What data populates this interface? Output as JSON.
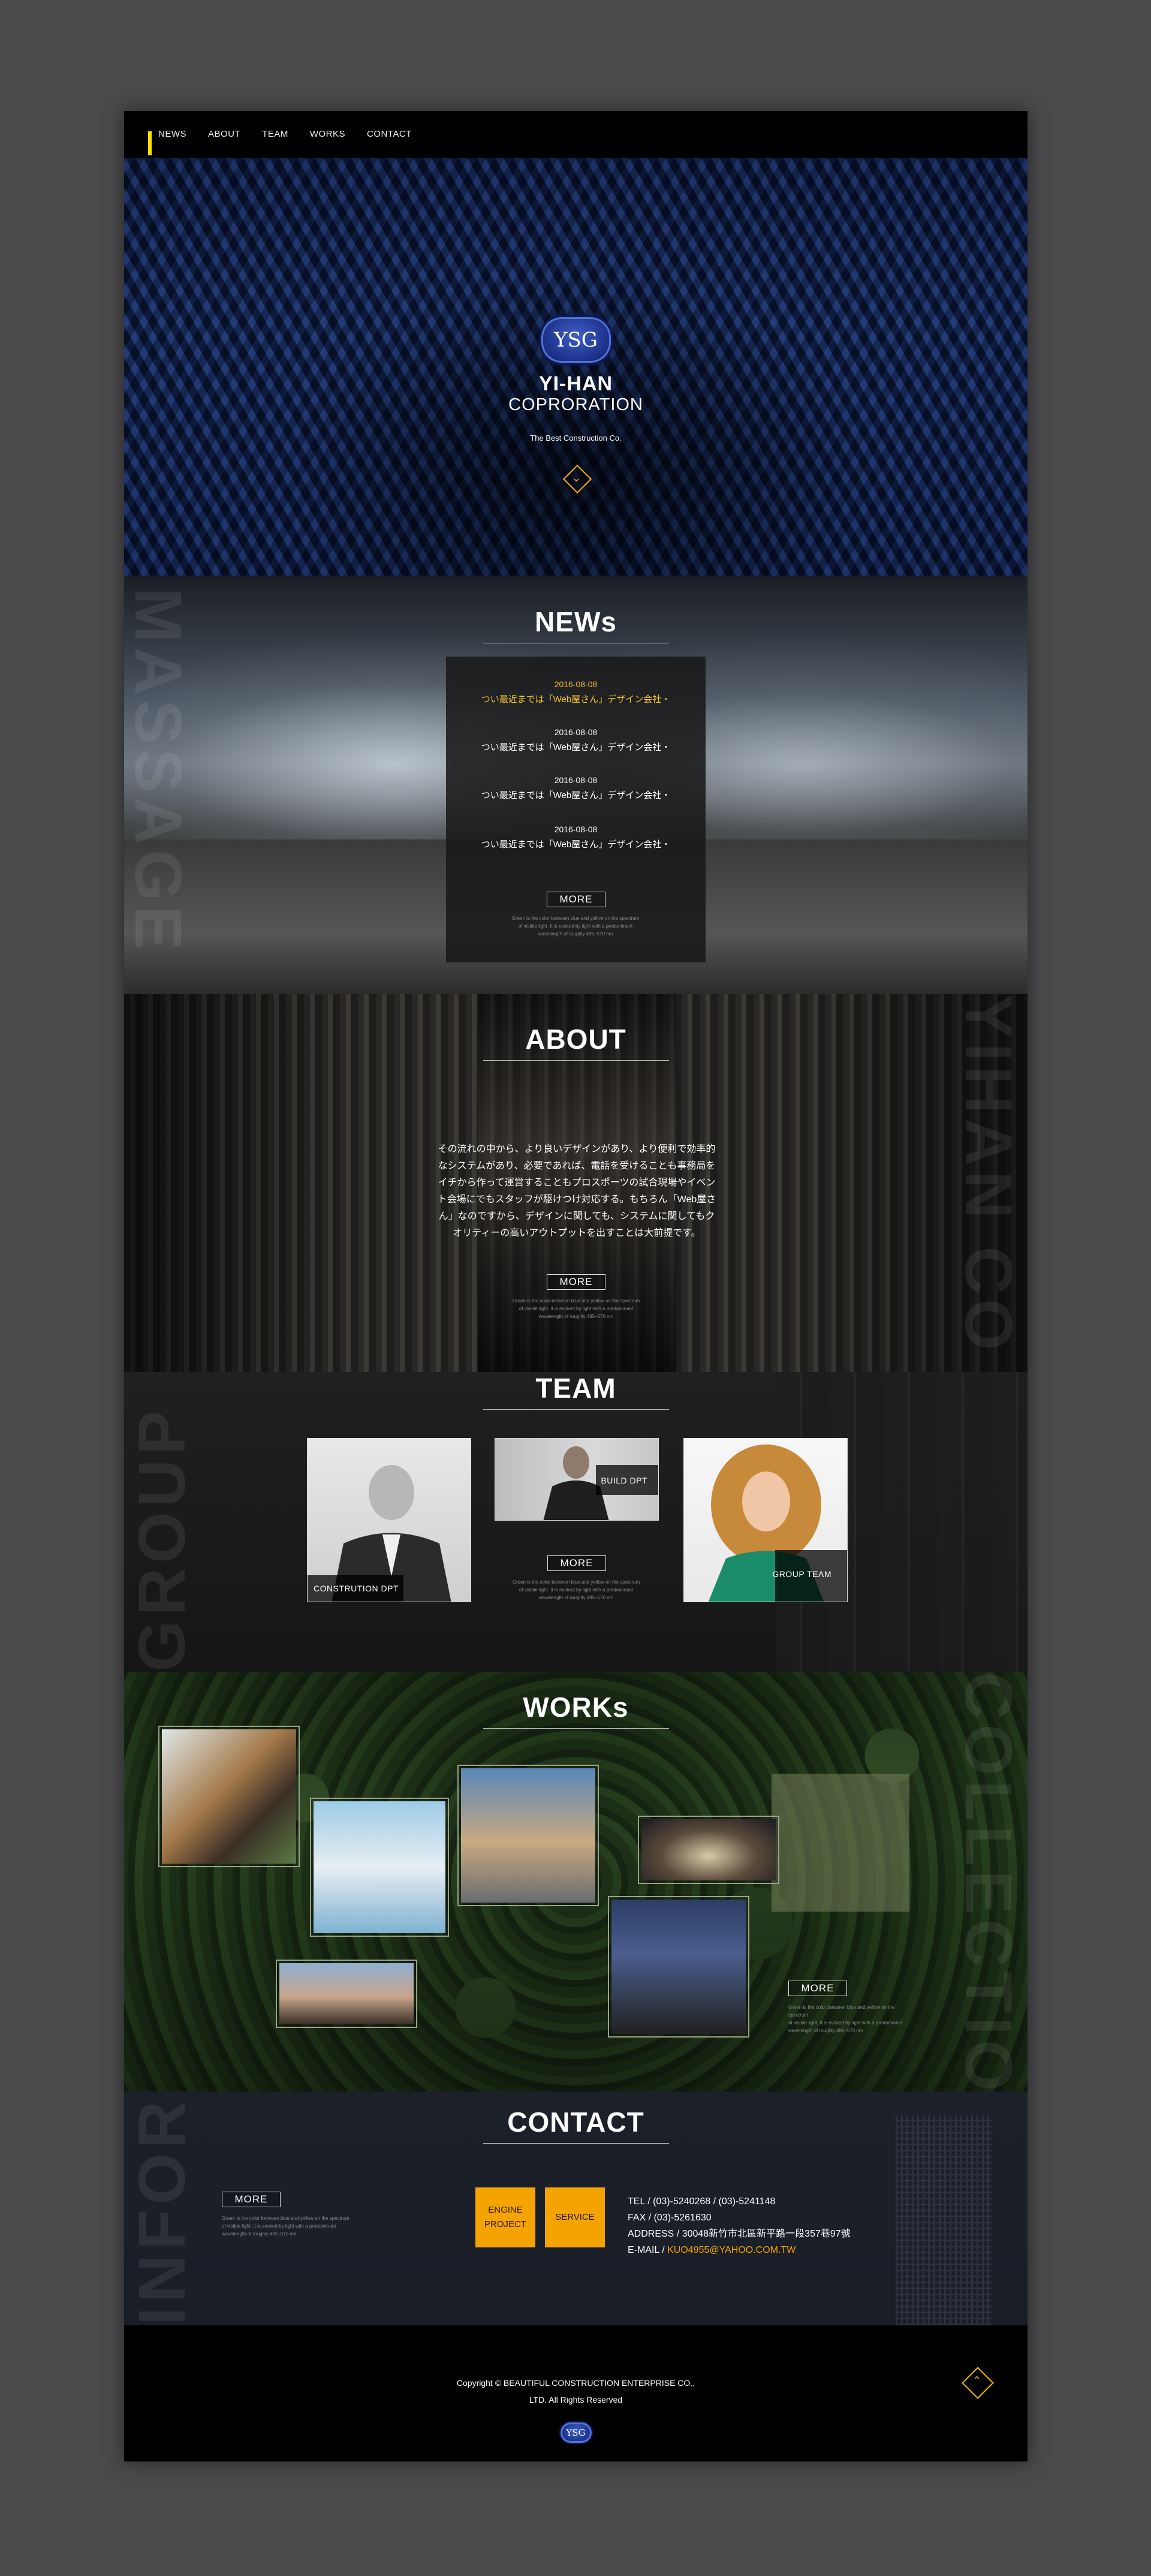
{
  "nav": [
    "NEWS",
    "ABOUT",
    "TEAM",
    "WORKS",
    "CONTACT"
  ],
  "hero": {
    "logo": "YSG",
    "brand": "YI-HAN",
    "brand2": "COPRORATION",
    "tagline": "The Best Construction Co."
  },
  "news": {
    "title": "NEWs",
    "side": "MASSAGE",
    "items": [
      {
        "date": "2016-08-08",
        "text": "つい最近までは「Web屋さん」デザイン会社・"
      },
      {
        "date": "2016-08-08",
        "text": "つい最近までは「Web屋さん」デザイン会社・"
      },
      {
        "date": "2016-08-08",
        "text": "つい最近までは「Web屋さん」デザイン会社・"
      },
      {
        "date": "2016-08-08",
        "text": "つい最近までは「Web屋さん」デザイン会社・"
      }
    ],
    "more": "MORE",
    "fine": "Green is the color between blue and yellow on the spectrum\nof visible light. It is evoked by light with a predominant\nwavelength of roughly 495–570 nm"
  },
  "about": {
    "title": "ABOUT",
    "side": "YIHAN CO",
    "text": "その流れの中から、より良いデザインがあり、より便利で効率的なシステムがあり、必要であれば、電話を受けることも事務局をイチから作って運営することもプロスポーツの試合現場やイベント会場にでもスタッフが駆けつけ対応する。もちろん「Web屋さん」なのですから、デザインに関しても、システムに関してもクオリティーの高いアウトプットを出すことは大前提です。",
    "more": "MORE",
    "fine": "Green is the color between blue and yellow on the spectrum\nof visible light. It is evoked by light with a predominant\nwavelength of roughly 495–570 nm"
  },
  "team": {
    "title": "TEAM",
    "side": "GROUP",
    "members": [
      "CONSTRUTION DPT",
      "BUILD DPT",
      "GROUP TEAM"
    ],
    "more": "MORE",
    "fine": "Green is the color between blue and yellow on the spectrum\nof visible light. It is evoked by light with a predominant\nwavelength of roughly 495–570 nm"
  },
  "works": {
    "title": "WORKs",
    "side": "COLLECTION",
    "more": "MORE",
    "fine": "Green is the color between blue and yellow on the spectrum\nof visible light. It is evoked by light with a predominant\nwavelength of roughly 495–570 nm"
  },
  "contact": {
    "title": "CONTACT",
    "side": "INFORM",
    "more": "MORE",
    "fine": "Green is the color between blue and yellow on the spectrum\nof visible light. It is evoked by light with a predominant\nwavelength of roughly 495–570 nm",
    "btn1": "ENGINE\nPROJECT",
    "btn2": "SERVICE",
    "tel": "TEL  /  (03)-5240268 / (03)-5241148",
    "fax": "FAX  /  (03)-5261630",
    "address": "ADDRESS  /  30048新竹市北區新平路一段357巷97號",
    "email_label": "E-MAIL  /  ",
    "email": "KUO4955@YAHOO.COM.TW"
  },
  "footer": {
    "copy1": "Copyright © BEAUTIFUL CONSTRUCTION ENTERPRISE CO.,",
    "copy2": "LTD. All Rights Reserved",
    "logo": "YSG"
  },
  "colors": {
    "accent": "#f2b807",
    "nav_marker": "#ffe200",
    "button": "#f5a300"
  }
}
